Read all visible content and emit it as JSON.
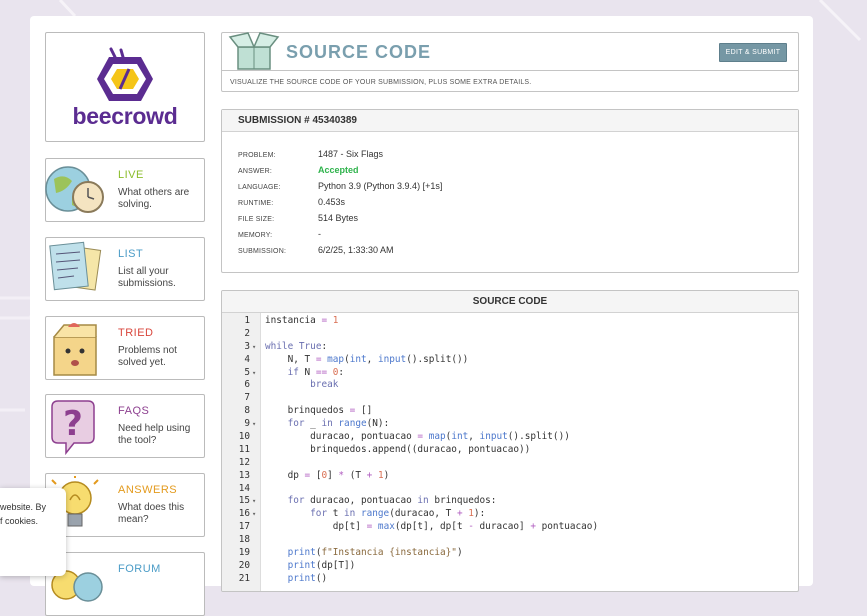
{
  "brand": {
    "name": "beecrowd"
  },
  "sidebar": {
    "items": [
      {
        "title": "LIVE",
        "desc": "What others are solving.",
        "color": "#8bbd2b",
        "icon": "globe-clock-icon"
      },
      {
        "title": "LIST",
        "desc": "List all your submissions.",
        "color": "#4b9cc7",
        "icon": "papers-icon"
      },
      {
        "title": "TRIED",
        "desc": "Problems not solved yet.",
        "color": "#d9463c",
        "icon": "box-face-icon"
      },
      {
        "title": "FAQS",
        "desc": "Need help using the tool?",
        "color": "#8d3f8f",
        "icon": "question-bubble-icon"
      },
      {
        "title": "ANSWERS",
        "desc": "What does this mean?",
        "color": "#e39a1d",
        "icon": "lightbulb-icon"
      },
      {
        "title": "FORUM",
        "desc": "",
        "color": "#4b9cc7",
        "icon": "forum-icon"
      }
    ]
  },
  "header": {
    "title": "SOURCE CODE",
    "button": "EDIT & SUBMIT",
    "subtitle": "VISUALIZE THE SOURCE CODE OF YOUR SUBMISSION, PLUS SOME EXTRA DETAILS."
  },
  "submission": {
    "title": "SUBMISSION # 45340389",
    "rows": [
      {
        "label": "PROBLEM:",
        "value": "1487 - Six Flags"
      },
      {
        "label": "ANSWER:",
        "value": "Accepted"
      },
      {
        "label": "LANGUAGE:",
        "value": "Python 3.9 (Python 3.9.4) [+1s]"
      },
      {
        "label": "RUNTIME:",
        "value": "0.453s"
      },
      {
        "label": "FILE SIZE:",
        "value": "514 Bytes"
      },
      {
        "label": "MEMORY:",
        "value": "-"
      },
      {
        "label": "SUBMISSION:",
        "value": "6/2/25, 1:33:30 AM"
      }
    ]
  },
  "source": {
    "title": "SOURCE CODE",
    "lines": [
      {
        "n": "1",
        "fold": "",
        "code": "instancia = 1"
      },
      {
        "n": "2",
        "fold": "",
        "code": ""
      },
      {
        "n": "3",
        "fold": "▾",
        "code": "while True:"
      },
      {
        "n": "4",
        "fold": "",
        "code": "    N, T = map(int, input().split())"
      },
      {
        "n": "5",
        "fold": "▾",
        "code": "    if N == 0:"
      },
      {
        "n": "6",
        "fold": "",
        "code": "        break"
      },
      {
        "n": "7",
        "fold": "",
        "code": ""
      },
      {
        "n": "8",
        "fold": "",
        "code": "    brinquedos = []"
      },
      {
        "n": "9",
        "fold": "▾",
        "code": "    for _ in range(N):"
      },
      {
        "n": "10",
        "fold": "",
        "code": "        duracao, pontuacao = map(int, input().split())"
      },
      {
        "n": "11",
        "fold": "",
        "code": "        brinquedos.append((duracao, pontuacao))"
      },
      {
        "n": "12",
        "fold": "",
        "code": ""
      },
      {
        "n": "13",
        "fold": "",
        "code": "    dp = [0] * (T + 1)"
      },
      {
        "n": "14",
        "fold": "",
        "code": ""
      },
      {
        "n": "15",
        "fold": "▾",
        "code": "    for duracao, pontuacao in brinquedos:"
      },
      {
        "n": "16",
        "fold": "▾",
        "code": "        for t in range(duracao, T + 1):"
      },
      {
        "n": "17",
        "fold": "",
        "code": "            dp[t] = max(dp[t], dp[t - duracao] + pontuacao)"
      },
      {
        "n": "18",
        "fold": "",
        "code": ""
      },
      {
        "n": "19",
        "fold": "",
        "code": "    print(f\"Instancia {instancia}\")"
      },
      {
        "n": "20",
        "fold": "",
        "code": "    print(dp[T])"
      },
      {
        "n": "21",
        "fold": "",
        "code": "    print()"
      }
    ]
  },
  "cookie": {
    "line1": "website. By",
    "line2": "f cookies."
  },
  "colors": {
    "accent": "#7a9fae",
    "button": "#7597a4",
    "brand": "#5b2c91",
    "accepted": "#2fb34c"
  }
}
